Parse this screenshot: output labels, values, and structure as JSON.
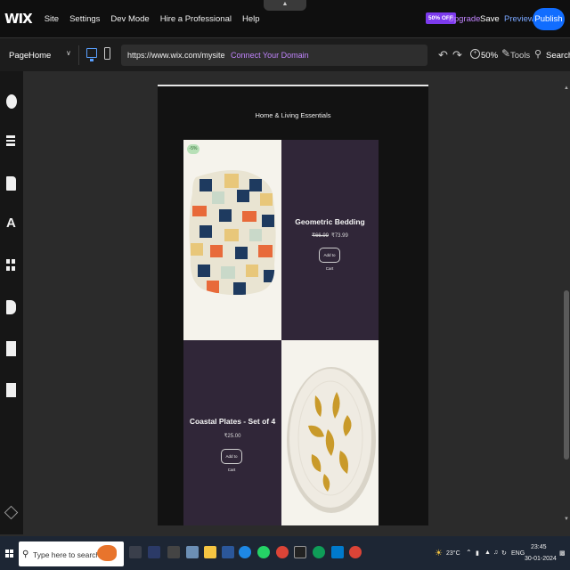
{
  "topbar": {
    "logo": "WIX",
    "menu": [
      "Site",
      "Settings",
      "Dev Mode",
      "Hire a Professional",
      "Help"
    ],
    "notch": "▲",
    "discount_badge": "50% OFF",
    "upgrade": "Upgrade",
    "save": "Save",
    "preview": "Preview",
    "publish": "Publish"
  },
  "toolbar": {
    "page_label": "Page:",
    "page_value": "Home",
    "url": "https://www.wix.com/mysite",
    "connect_domain": "Connect Your Domain",
    "zoom": "50%",
    "tools": "Tools",
    "search": "Search"
  },
  "site": {
    "heading": "Home & Living Essentials",
    "products": [
      {
        "sale_badge": "-5%",
        "name": "Geometric Bedding",
        "old_price": "₹66.99",
        "price": "₹73.99",
        "cart_button": "Add to Cart"
      },
      {
        "name": "Coastal Plates - Set of 4",
        "price": "₹25.00",
        "cart_button": "Add to Cart"
      }
    ]
  },
  "taskbar": {
    "search_placeholder": "Type here to search",
    "temperature": "23°C",
    "language": "ENG",
    "time": "23:45",
    "date": "30-01-2024"
  },
  "colors": {
    "accent_blue": "#116dff",
    "upgrade_purple": "#c084fc",
    "product_tile": "#302638"
  }
}
